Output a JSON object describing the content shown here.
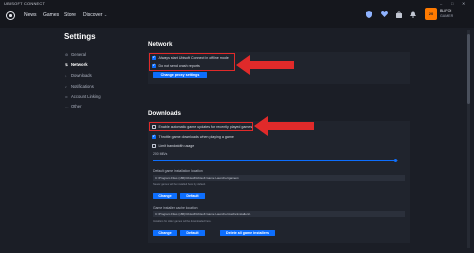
{
  "window": {
    "title": "UBISOFT CONNECT",
    "controls": [
      "–",
      "□",
      "✕"
    ]
  },
  "nav": {
    "items": [
      "News",
      "Games",
      "Store",
      "Discover"
    ],
    "discover_caret": "⌄"
  },
  "header_icons": [
    "shield-icon",
    "heart-icon",
    "bag-icon",
    "bell-icon",
    "friends-icon"
  ],
  "user": {
    "avatar_text": "20",
    "name": "BLIFOI",
    "status": "GAMER"
  },
  "page_title": "Settings",
  "sidebar": {
    "items": [
      {
        "label": "General",
        "icon": "gear-icon",
        "active": false
      },
      {
        "label": "Network",
        "icon": "network-icon",
        "active": true
      },
      {
        "label": "Downloads",
        "icon": "download-icon",
        "active": false
      },
      {
        "label": "Notifications",
        "icon": "bell-icon",
        "active": false
      },
      {
        "label": "Account Linking",
        "icon": "link-icon",
        "active": false
      },
      {
        "label": "Other",
        "icon": "dots-icon",
        "active": false
      }
    ]
  },
  "network": {
    "title": "Network",
    "options": [
      {
        "label": "Always start Ubisoft Connect in offline mode",
        "checked": true
      },
      {
        "label": "Do not send crash reports",
        "checked": true
      }
    ],
    "proxy_button": "Change proxy settings"
  },
  "downloads": {
    "title": "Downloads",
    "options": [
      {
        "label": "Enable automatic game updates for recently played games",
        "checked": false
      },
      {
        "label": "Throttle game downloads when playing a game",
        "checked": true
      },
      {
        "label": "Limit bandwidth usage",
        "checked": false
      }
    ],
    "bandwidth_value": "200 MB/s",
    "default_location": {
      "label": "Default game installation location",
      "path": "C:\\Program Files (x86)\\Ubisoft\\Ubisoft Game Launcher\\games\\",
      "hint": "Newer games will be installed here by default.",
      "change": "Change",
      "default": "Default"
    },
    "cache_location": {
      "label": "Game installer cache location",
      "path": "C:\\Program Files (x86)\\Ubisoft\\Ubisoft Game Launcher\\cache\\installers\\",
      "hint": "Installers for older games will be downloaded here.",
      "change": "Change",
      "default": "Default",
      "delete": "Delete all game installers"
    }
  },
  "colors": {
    "accent": "#0d6efd",
    "annotation": "#e02a2a",
    "background": "#1b1e26"
  }
}
